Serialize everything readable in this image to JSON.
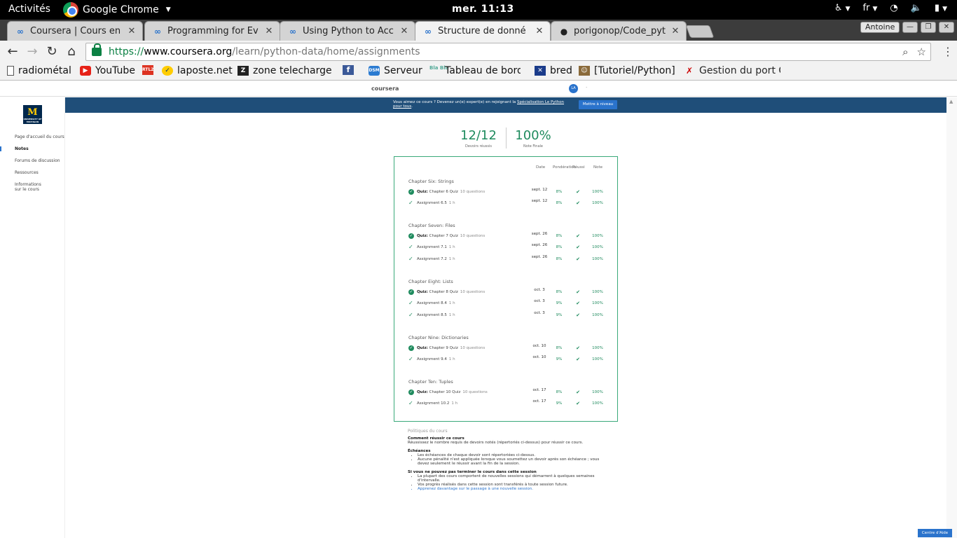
{
  "topbar": {
    "activities": "Activités",
    "app_name": "Google Chrome",
    "clock": "mer. 11:13",
    "lang": "fr"
  },
  "tabs": [
    {
      "title": "Coursera | Cours en",
      "favicon": "coursera-icon"
    },
    {
      "title": "Programming for Ev",
      "favicon": "coursera-icon"
    },
    {
      "title": "Using Python to Acc",
      "favicon": "coursera-icon"
    },
    {
      "title": "Structure de donné",
      "favicon": "coursera-icon",
      "active": true
    },
    {
      "title": "porigonop/Code_pyt",
      "favicon": "github-icon"
    }
  ],
  "profile_name": "Antoine",
  "url": {
    "scheme": "https://",
    "host": "www.coursera.org",
    "path": "/learn/python-data/home/assignments"
  },
  "bookmarks": [
    "radiométal",
    "YouTube",
    "laposte.net",
    "zone telechargem",
    "",
    "Serveur",
    "Tableau de bord",
    "bred",
    "[Tutoriel/Python]",
    "Gestion du port G"
  ],
  "coursera": {
    "logo": "coursera",
    "avatar": "LA",
    "banner_text_pre": "Vous aimez ce cours ? Devenez un(e) expert(e) en rejoignant la ",
    "banner_link": "Spécialisation Le Python pour tous",
    "banner_text_post": ".",
    "banner_button": "Mettre à niveau"
  },
  "sidebar": {
    "items": [
      {
        "label": "Page d'accueil du cours"
      },
      {
        "label": "Notes",
        "active": true
      },
      {
        "label": "Forums de discussion"
      },
      {
        "label": "Ressources"
      },
      {
        "label": "Informations sur le cours"
      }
    ]
  },
  "summary": {
    "passed_value": "12/12",
    "passed_label": "Devoirs réussis",
    "grade_value": "100%",
    "grade_label": "Note Finale"
  },
  "table": {
    "headers": {
      "date": "Date",
      "weight": "Pondération",
      "passed": "Réussi",
      "grade": "Note"
    },
    "chapters": [
      {
        "title": "Chapter Six: Strings",
        "rows": [
          {
            "type": "quiz",
            "prefix": "Quiz:",
            "name": "Chapter 6 Quiz",
            "meta": "10 questions",
            "date": "sept. 12",
            "weight": "8%",
            "grade": "100%"
          },
          {
            "type": "assignment",
            "prefix": "",
            "name": "Assignment 6.5",
            "meta": "1 h",
            "date": "sept. 12",
            "weight": "8%",
            "grade": "100%"
          }
        ]
      },
      {
        "title": "Chapter Seven: Files",
        "rows": [
          {
            "type": "quiz",
            "prefix": "Quiz:",
            "name": "Chapter 7 Quiz",
            "meta": "10 questions",
            "date": "sept. 26",
            "weight": "8%",
            "grade": "100%"
          },
          {
            "type": "assignment",
            "prefix": "",
            "name": "Assignment 7.1",
            "meta": "1 h",
            "date": "sept. 26",
            "weight": "8%",
            "grade": "100%"
          },
          {
            "type": "assignment",
            "prefix": "",
            "name": "Assignment 7.2",
            "meta": "1 h",
            "date": "sept. 26",
            "weight": "8%",
            "grade": "100%"
          }
        ]
      },
      {
        "title": "Chapter Eight: Lists",
        "rows": [
          {
            "type": "quiz",
            "prefix": "Quiz:",
            "name": "Chapter 8 Quiz",
            "meta": "10 questions",
            "date": "oct. 3",
            "weight": "8%",
            "grade": "100%"
          },
          {
            "type": "assignment",
            "prefix": "",
            "name": "Assignment 8.4",
            "meta": "1 h",
            "date": "oct. 3",
            "weight": "9%",
            "grade": "100%"
          },
          {
            "type": "assignment",
            "prefix": "",
            "name": "Assignment 8.5",
            "meta": "1 h",
            "date": "oct. 3",
            "weight": "9%",
            "grade": "100%"
          }
        ]
      },
      {
        "title": "Chapter Nine: Dictionaries",
        "rows": [
          {
            "type": "quiz",
            "prefix": "Quiz:",
            "name": "Chapter 9 Quiz",
            "meta": "10 questions",
            "date": "oct. 10",
            "weight": "8%",
            "grade": "100%"
          },
          {
            "type": "assignment",
            "prefix": "",
            "name": "Assignment 9.4",
            "meta": "1 h",
            "date": "oct. 10",
            "weight": "9%",
            "grade": "100%"
          }
        ]
      },
      {
        "title": "Chapter Ten: Tuples",
        "rows": [
          {
            "type": "quiz",
            "prefix": "Quiz:",
            "name": "Chapter 10 Quiz",
            "meta": "10 questions",
            "date": "oct. 17",
            "weight": "8%",
            "grade": "100%"
          },
          {
            "type": "assignment",
            "prefix": "",
            "name": "Assignment 10.2",
            "meta": "1 h",
            "date": "oct. 17",
            "weight": "9%",
            "grade": "100%"
          }
        ]
      }
    ]
  },
  "policies": {
    "title": "Politiques du cours",
    "pass_heading": "Comment réussir ce cours",
    "pass_text": "Réussissez le nombre requis de devoirs notés (répertoriés ci-dessus) pour réussir ce cours.",
    "deadlines_heading": "Échéances",
    "deadlines": [
      "Les échéances de chaque devoir sont répertoriées ci-dessus.",
      "Aucune pénalité n'est appliquée lorsque vous soumettez un devoir après son échéance ; vous devez seulement le réussir avant la fin de la session."
    ],
    "session_heading": "Si vous ne pouvez pas terminer le cours dans cette session",
    "session_items": [
      "La plupart des cours comportent de nouvelles sessions qui démarrent à quelques semaines d'intervalle.",
      "Vos progrès réalisés dans cette session sont transférés à toute session future."
    ],
    "session_link": "Apprenez davantage sur le passage à une nouvelle session."
  },
  "help_button": "Centre d'Aide",
  "colors": {
    "accent": "#2a73cc",
    "success": "#1f8b5e",
    "banner": "#1f4e79"
  }
}
